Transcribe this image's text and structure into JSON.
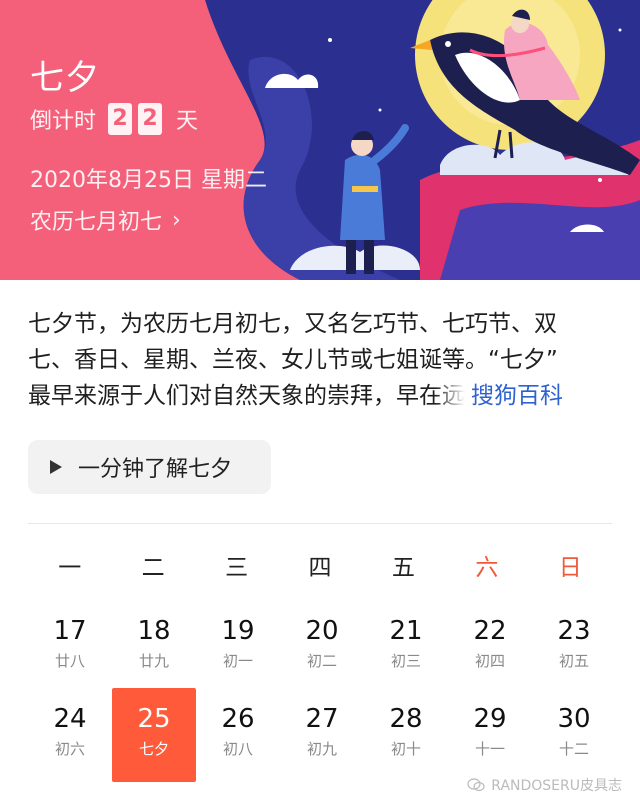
{
  "banner": {
    "title": "七夕",
    "countdown_label": "倒计时",
    "countdown_digits": [
      "2",
      "2"
    ],
    "countdown_unit": "天",
    "date": "2020年8月25日 星期二",
    "lunar_date": "农历七月初七",
    "chevron": "›",
    "colors": {
      "background": "#f4607a",
      "night": "#2b2f8f",
      "moon": "#f6e27a"
    }
  },
  "description": {
    "lines": [
      "七夕节，为农历七月初七，又名乞巧节、七巧节、双",
      "七、香日、星期、兰夜、女儿节或七姐诞等。“七夕”",
      "最早来源于人们对自然天象的崇拜，早在远"
    ],
    "source": "搜狗百科"
  },
  "play_button": {
    "label": "一分钟了解七夕",
    "icon": "play-icon"
  },
  "calendar": {
    "weekdays": [
      "一",
      "二",
      "三",
      "四",
      "五",
      "六",
      "日"
    ],
    "weeks": [
      [
        {
          "day": "17",
          "lunar": "廿八"
        },
        {
          "day": "18",
          "lunar": "廿九"
        },
        {
          "day": "19",
          "lunar": "初一"
        },
        {
          "day": "20",
          "lunar": "初二"
        },
        {
          "day": "21",
          "lunar": "初三"
        },
        {
          "day": "22",
          "lunar": "初四"
        },
        {
          "day": "23",
          "lunar": "初五"
        }
      ],
      [
        {
          "day": "24",
          "lunar": "初六"
        },
        {
          "day": "25",
          "lunar": "七夕"
        },
        {
          "day": "26",
          "lunar": "初八"
        },
        {
          "day": "27",
          "lunar": "初九"
        },
        {
          "day": "28",
          "lunar": "初十"
        },
        {
          "day": "29",
          "lunar": "十一"
        },
        {
          "day": "30",
          "lunar": "十二"
        }
      ]
    ],
    "selected_day": "25",
    "accent_color": "#ff5a3a"
  },
  "watermark": "RANDOSERU皮具志"
}
